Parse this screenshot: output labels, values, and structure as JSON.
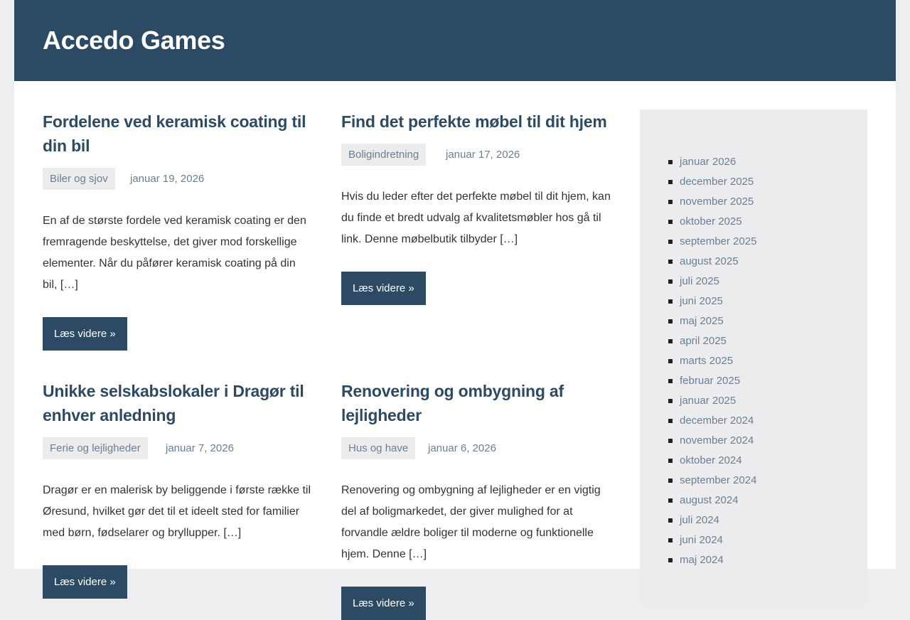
{
  "header": {
    "site_title": "Accedo Games"
  },
  "posts": [
    {
      "title": "Fordelene ved keramisk coating til din bil",
      "category": "Biler og sjov",
      "date": "januar 19, 2026",
      "excerpt": "En af de største fordele ved keramisk coating er den fremragende beskyttelse, det giver mod forskellige elementer. Når du påfører keramisk coating på din bil, […]",
      "more_label": "Læs videre »"
    },
    {
      "title": "Find det perfekte møbel til dit hjem",
      "category": "Boligindretning",
      "date": "januar 17, 2026",
      "excerpt": "Hvis du leder efter det perfekte møbel til dit hjem, kan du finde et bredt udvalg af kvalitetsmøbler hos gå til link. Denne møbelbutik tilbyder […]",
      "more_label": "Læs videre »"
    },
    {
      "title": "Unikke selskabslokaler i Dragør til enhver anledning",
      "category": "Ferie og lejligheder",
      "date": "januar 7, 2026",
      "excerpt": "Dragør er en malerisk by beliggende i første række til Øresund, hvilket gør det til et ideelt sted for familier med børn, fødselarer og bryllupper. […]",
      "more_label": "Læs videre »"
    },
    {
      "title": "Renovering og ombygning af lejligheder",
      "category": "Hus og have",
      "date": "januar 6, 2026",
      "excerpt": "Renovering og ombygning af lejligheder er en vigtig del af boligmarkedet, der giver mulighed for at forvandle ældre boliger til moderne og funktionelle hjem. Denne […]",
      "more_label": "Læs videre »"
    }
  ],
  "sidebar": {
    "archive": [
      "januar 2026",
      "december 2025",
      "november 2025",
      "oktober 2025",
      "september 2025",
      "august 2025",
      "juli 2025",
      "juni 2025",
      "maj 2025",
      "april 2025",
      "marts 2025",
      "februar 2025",
      "januar 2025",
      "december 2024",
      "november 2024",
      "oktober 2024",
      "september 2024",
      "august 2024",
      "juli 2024",
      "juni 2024",
      "maj 2024"
    ]
  },
  "colors": {
    "primary": "#2c4a63",
    "meta": "#6a7f93",
    "background": "#eeeef0"
  }
}
